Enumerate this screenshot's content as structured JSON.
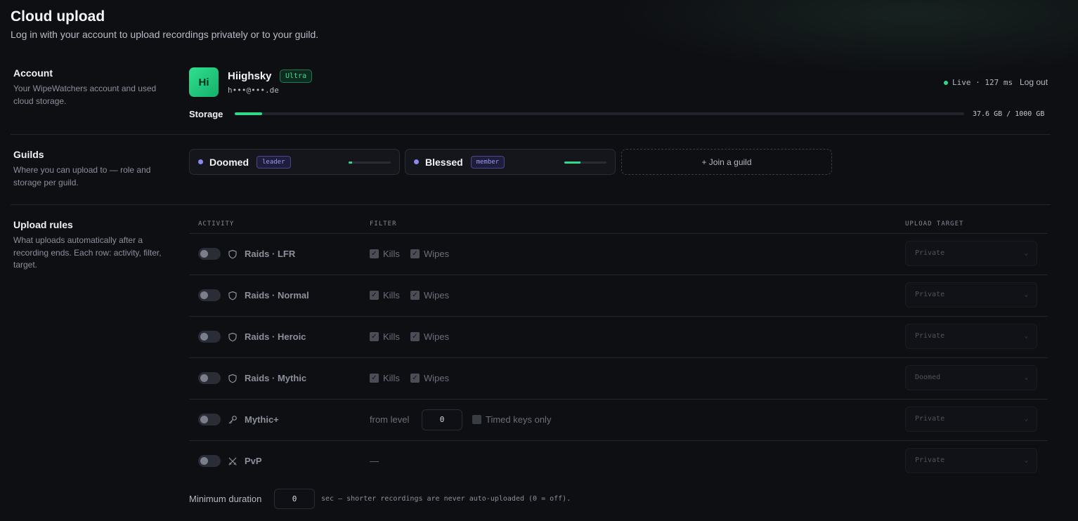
{
  "page": {
    "title": "Cloud upload",
    "subtitle": "Log in with your account to upload recordings privately or to your guild."
  },
  "account": {
    "heading": "Account",
    "description": "Your WipeWatchers account and used cloud storage.",
    "avatar_initials": "Hi",
    "username": "Hiighsky",
    "tier_badge": "Ultra",
    "email": "h•••@•••.de",
    "status": "Live · 127 ms",
    "logout_label": "Log out",
    "storage_label": "Storage",
    "storage_text": "37.6 GB / 1000 GB",
    "storage_used_fraction": 0.0376
  },
  "guilds": {
    "heading": "Guilds",
    "description": "Where you can upload to — role and storage per guild.",
    "items": [
      {
        "name": "Doomed",
        "role": "leader",
        "storage_fraction": 0.08
      },
      {
        "name": "Blessed",
        "role": "member",
        "storage_fraction": 0.38
      }
    ],
    "join_label": "+ Join a guild"
  },
  "rules": {
    "heading": "Upload rules",
    "description": "What uploads automatically after a recording ends. Each row: activity, filter, target.",
    "columns": {
      "activity": "ACTIVITY",
      "filter": "FILTER",
      "target": "UPLOAD TARGET"
    },
    "rows": [
      {
        "activity": "Raids · LFR",
        "icon": "shield-icon",
        "kills": "Kills",
        "wipes": "Wipes",
        "target": "Private"
      },
      {
        "activity": "Raids · Normal",
        "icon": "shield-icon",
        "kills": "Kills",
        "wipes": "Wipes",
        "target": "Private"
      },
      {
        "activity": "Raids · Heroic",
        "icon": "shield-icon",
        "kills": "Kills",
        "wipes": "Wipes",
        "target": "Private"
      },
      {
        "activity": "Raids · Mythic",
        "icon": "shield-icon",
        "kills": "Kills",
        "wipes": "Wipes",
        "target": "Doomed"
      },
      {
        "activity": "Mythic+",
        "icon": "key-icon",
        "from_level_label": "from level",
        "from_level_value": "0",
        "timed_label": "Timed keys only",
        "target": "Private"
      },
      {
        "activity": "PvP",
        "icon": "swords-icon",
        "filter_text": "—",
        "target": "Private"
      }
    ],
    "min_duration_label": "Minimum duration",
    "min_duration_value": "0",
    "min_duration_note": "sec — shorter recordings are never auto-uploaded (0 = off)."
  },
  "colors": {
    "accent": "#2fd98a",
    "guild_dot": "#8b88f0",
    "background": "#0e0f13"
  }
}
